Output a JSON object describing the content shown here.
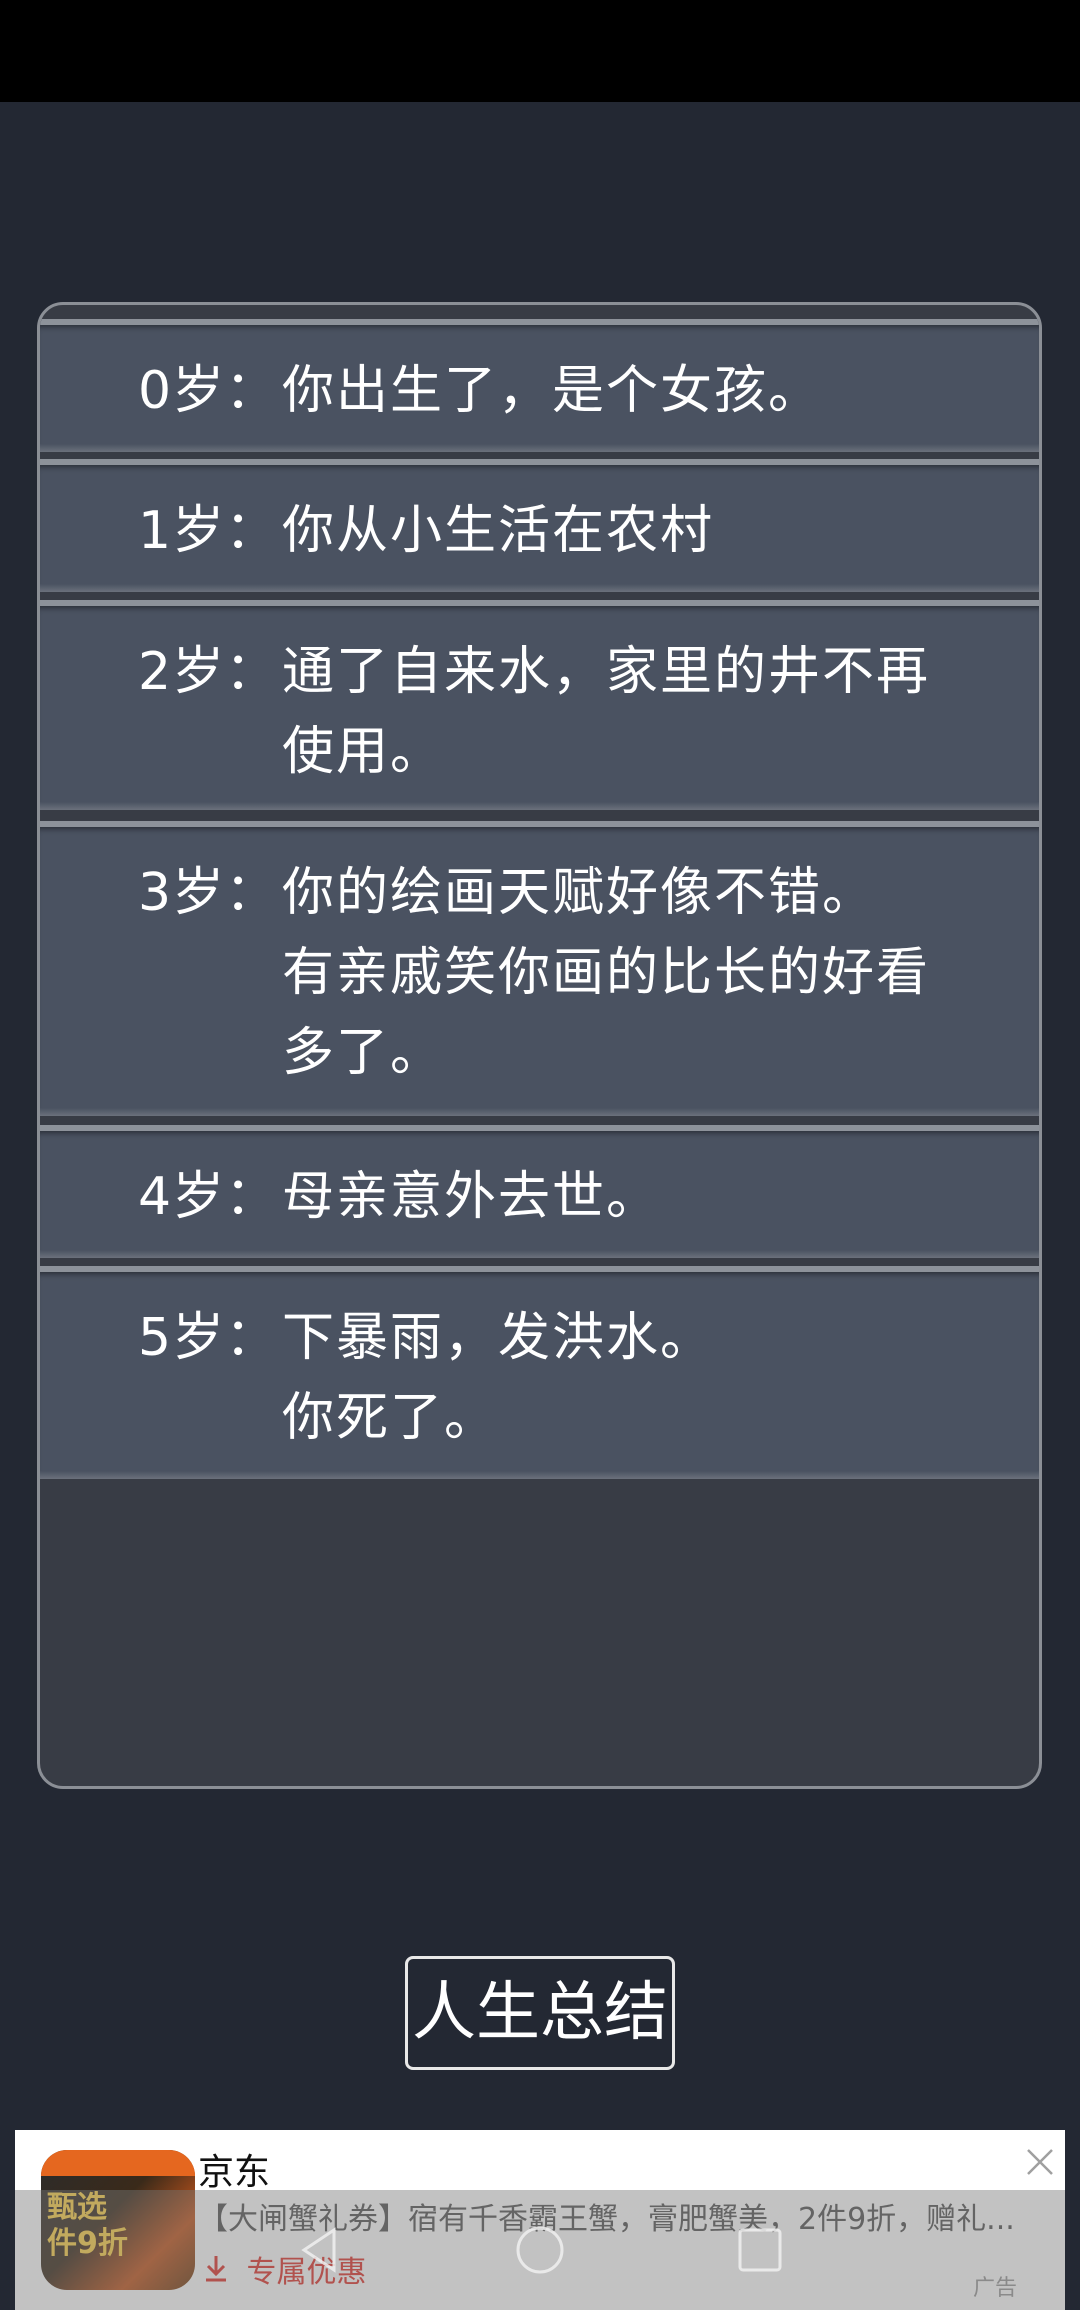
{
  "events": [
    {
      "age": "0岁：",
      "lines": [
        "你出生了，是个女孩。"
      ]
    },
    {
      "age": "1岁：",
      "lines": [
        "你从小生活在农村"
      ]
    },
    {
      "age": "2岁：",
      "lines": [
        "通了自来水，家里的井不再",
        "使用。"
      ]
    },
    {
      "age": "3岁：",
      "lines": [
        "你的绘画天赋好像不错。",
        "有亲戚笑你画的比长的好看",
        "多了。"
      ]
    },
    {
      "age": "4岁：",
      "lines": [
        "母亲意外去世。"
      ]
    },
    {
      "age": "5岁：",
      "lines": [
        "下暴雨，发洪水。",
        "你死了。"
      ]
    }
  ],
  "summary_button": {
    "label": "人生总结"
  },
  "ad": {
    "brand": "京东",
    "description": "【大闸蟹礼券】宿有千香霸王蟹，膏肥蟹美，2件9折，赠礼...",
    "cta": "专属优惠",
    "tag": "广告",
    "thumb_text": "甄选\n件9折",
    "close_icon": "close-icon"
  },
  "nav": {
    "back_icon": "back-triangle-icon",
    "home_icon": "home-circle-icon",
    "recents_icon": "recents-square-icon"
  },
  "colors": {
    "background": "#232833",
    "panel": "#383c45",
    "row": "#4a5261",
    "cta": "#e0342c"
  }
}
